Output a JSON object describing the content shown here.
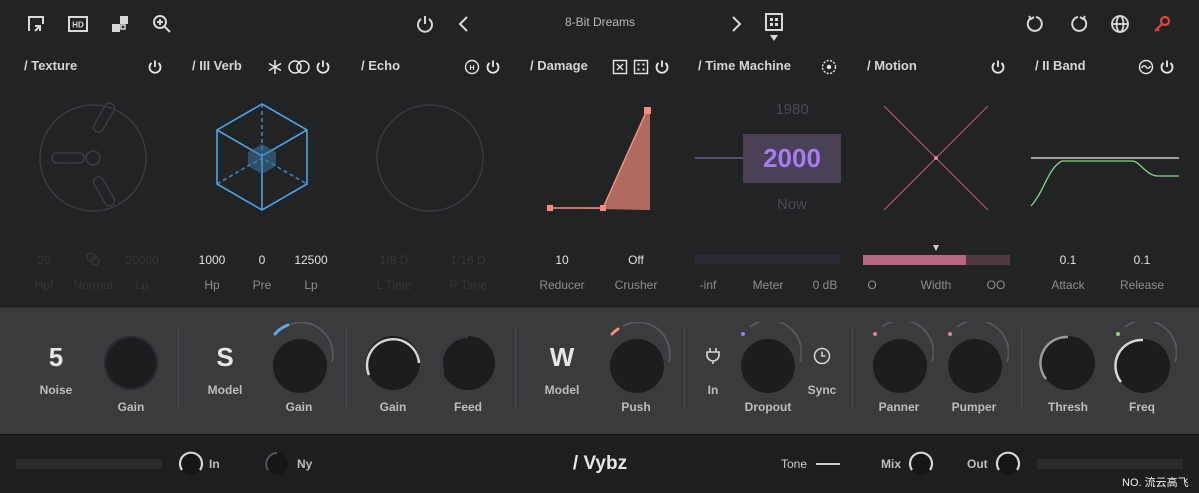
{
  "toolbar": {
    "preset_name": "8-Bit Dreams",
    "icons": [
      "resize-icon",
      "hd-icon",
      "randomize-icon",
      "zoom-icon",
      "power-icon",
      "previous-preset-icon",
      "next-preset-icon",
      "preset-browser-icon",
      "undo-icon",
      "redo-icon",
      "globe-icon",
      "key-icon"
    ]
  },
  "modules": {
    "texture": {
      "title": "/ Texture",
      "params": [
        {
          "value": "20",
          "label": "Hpf"
        },
        {
          "value": "",
          "label": "Normal"
        },
        {
          "value": "20000",
          "label": "Lp"
        }
      ]
    },
    "verb": {
      "title": "/ III Verb",
      "params": [
        {
          "value": "1000",
          "label": "Hp"
        },
        {
          "value": "0",
          "label": "Pre"
        },
        {
          "value": "12500",
          "label": "Lp"
        }
      ]
    },
    "echo": {
      "title": "/ Echo",
      "params": [
        {
          "value": "1/8 D",
          "label": "L Time"
        },
        {
          "value": "1/16 D",
          "label": "R Time"
        }
      ]
    },
    "damage": {
      "title": "/ Damage",
      "params": [
        {
          "value": "10",
          "label": "Reducer"
        },
        {
          "value": "Off",
          "label": "Crusher"
        }
      ]
    },
    "time_machine": {
      "title": "/ Time Machine",
      "year_prev": "1980",
      "year_current": "2000",
      "year_next": "Now",
      "meter_labels": [
        "-inf",
        "Meter",
        "0 dB"
      ]
    },
    "motion": {
      "title": "/ Motion",
      "width_labels": [
        "O",
        "Width",
        "OO"
      ],
      "width_level": 0.7
    },
    "band": {
      "title": "/ II Band",
      "params": [
        {
          "value": "0.1",
          "label": "Attack"
        },
        {
          "value": "0.1",
          "label": "Release"
        }
      ]
    }
  },
  "knobs": {
    "noise": {
      "value": "5",
      "label": "Noise"
    },
    "noise_gain": {
      "label": "Gain"
    },
    "verb_model": {
      "value": "S",
      "label": "Model"
    },
    "verb_gain": {
      "label": "Gain"
    },
    "echo_gain": {
      "label": "Gain"
    },
    "echo_feed": {
      "label": "Feed"
    },
    "damage_model": {
      "value": "W",
      "label": "Model"
    },
    "damage_push": {
      "label": "Push"
    },
    "tm_in": {
      "label": "In"
    },
    "tm_dropout": {
      "label": "Dropout"
    },
    "tm_sync": {
      "label": "Sync"
    },
    "motion_panner": {
      "label": "Panner"
    },
    "motion_pumper": {
      "label": "Pumper"
    },
    "band_thresh": {
      "label": "Thresh"
    },
    "band_freq": {
      "label": "Freq"
    }
  },
  "bottom": {
    "in_label": "In",
    "ny_label": "Ny",
    "brand": "/ Vybz",
    "tone_label": "Tone",
    "mix_label": "Mix",
    "out_label": "Out"
  },
  "watermark": "NO. 流云高飞",
  "colors": {
    "accent_blue": "#5aa9e6",
    "accent_salmon": "#f28e7c",
    "accent_purple": "#a67cf2",
    "accent_pink": "#e07fa0",
    "accent_green": "#7fdc7f"
  }
}
